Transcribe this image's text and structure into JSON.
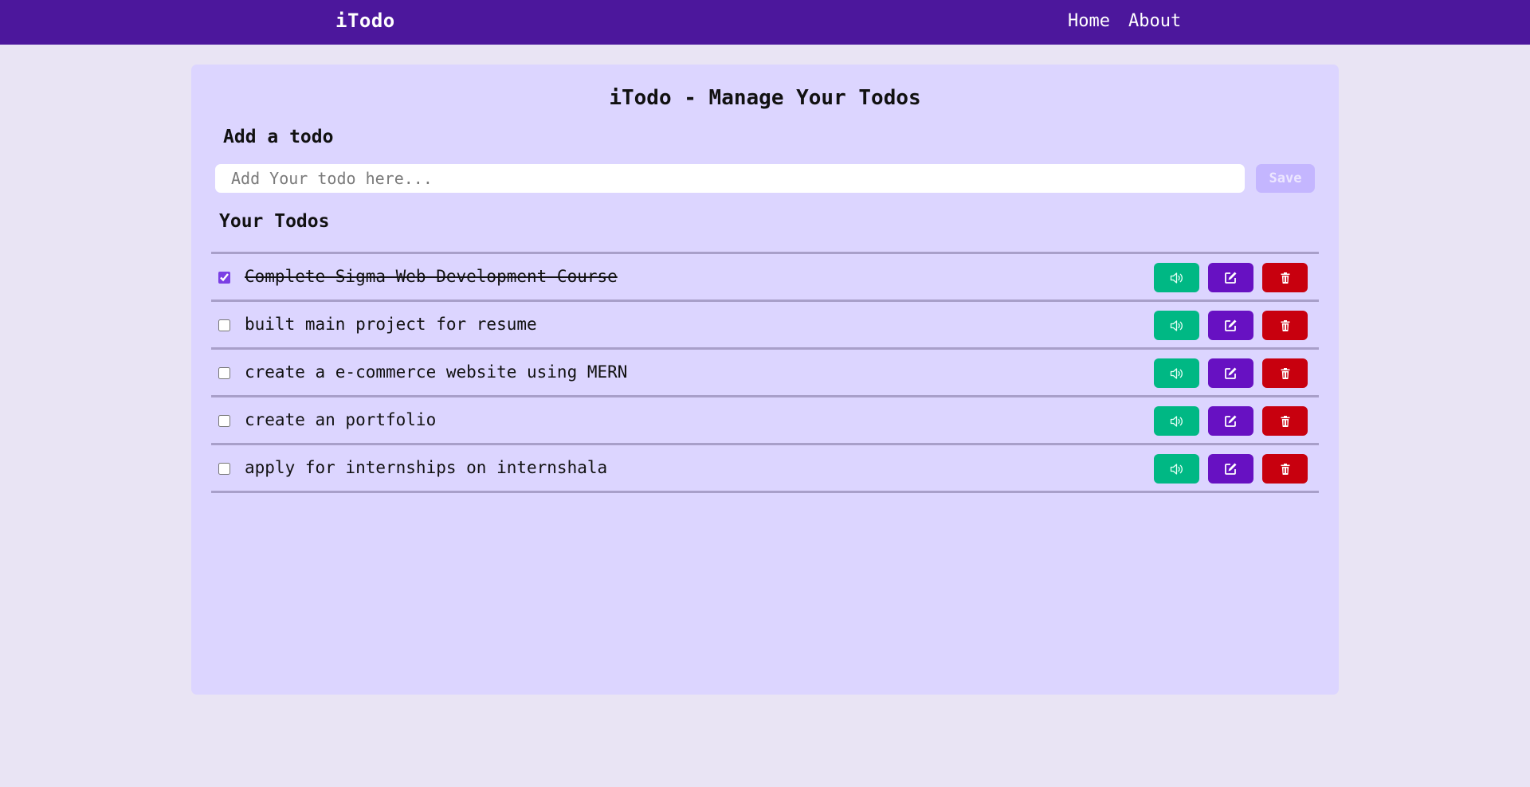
{
  "navbar": {
    "brand": "iTodo",
    "links": [
      {
        "label": "Home"
      },
      {
        "label": "About"
      }
    ]
  },
  "main": {
    "title": "iTodo - Manage Your Todos",
    "add_heading": "Add a todo",
    "input": {
      "placeholder": "Add Your todo here...",
      "value": ""
    },
    "save_label": "Save",
    "todos_heading": "Your Todos",
    "todos": [
      {
        "text": "Complete Sigma Web Development Course",
        "completed": true
      },
      {
        "text": "built main project for resume",
        "completed": false
      },
      {
        "text": "create a e-commerce website using MERN",
        "completed": false
      },
      {
        "text": "create an portfolio",
        "completed": false
      },
      {
        "text": "apply for internships on internshala",
        "completed": false
      }
    ],
    "actions": [
      {
        "icon": "speaker-icon",
        "color": "#00b884"
      },
      {
        "icon": "edit-icon",
        "color": "#6711c2"
      },
      {
        "icon": "trash-icon",
        "color": "#c8000e"
      }
    ]
  },
  "colors": {
    "navbar": "#4c179c",
    "page_background": "#e9e4f4",
    "card_background": "#dcd5ff",
    "save_button": "#c4b6ff"
  }
}
